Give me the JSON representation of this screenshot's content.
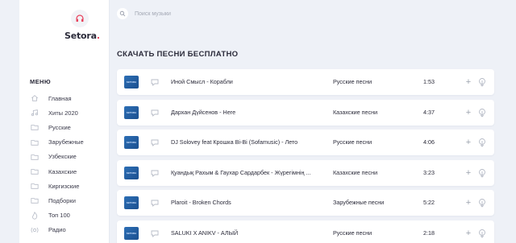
{
  "app": {
    "logo_name": "Setora",
    "logo_dot": "."
  },
  "search": {
    "placeholder": "Поиск музыки"
  },
  "menu": {
    "title": "МЕНЮ",
    "items": [
      {
        "label": "Главная",
        "icon": "home-icon"
      },
      {
        "label": "Хиты 2020",
        "icon": "music-note-icon"
      },
      {
        "label": "Русские",
        "icon": "folder-icon"
      },
      {
        "label": "Зарубежные",
        "icon": "folder-icon"
      },
      {
        "label": "Узбекские",
        "icon": "folder-icon"
      },
      {
        "label": "Казахские",
        "icon": "folder-icon"
      },
      {
        "label": "Киргизские",
        "icon": "folder-icon"
      },
      {
        "label": "Подборки",
        "icon": "folder-icon"
      },
      {
        "label": "Топ 100",
        "icon": "flame-icon"
      },
      {
        "label": "Радио",
        "icon": "radio-icon"
      }
    ]
  },
  "main": {
    "heading": "СКАЧАТЬ ПЕСНИ БЕСПЛАТНО",
    "tracks": [
      {
        "title": "Иной Смысл - Корабли",
        "genre": "Русские песни",
        "duration": "1:53"
      },
      {
        "title": "Дархан Дүйсенов - Неге",
        "genre": "Казахские песни",
        "duration": "4:37"
      },
      {
        "title": "DJ Solovey feat Крошка Bi-Bi (Sofamusic) - Лето",
        "genre": "Русские песни",
        "duration": "4:06"
      },
      {
        "title": "Қуандық Рахым & Гаухар Сардарбек - Жүрегімнің ...",
        "genre": "Казахские песни",
        "duration": "3:23"
      },
      {
        "title": "Plaroit - Broken Chords",
        "genre": "Зарубежные песни",
        "duration": "5:22"
      },
      {
        "title": "SALUKI X ANIKV - АЛЫЙ",
        "genre": "Русские песни",
        "duration": "2:18"
      }
    ]
  },
  "colors": {
    "accent": "#e8415b",
    "background": "#eef1f7",
    "card": "#ffffff"
  }
}
